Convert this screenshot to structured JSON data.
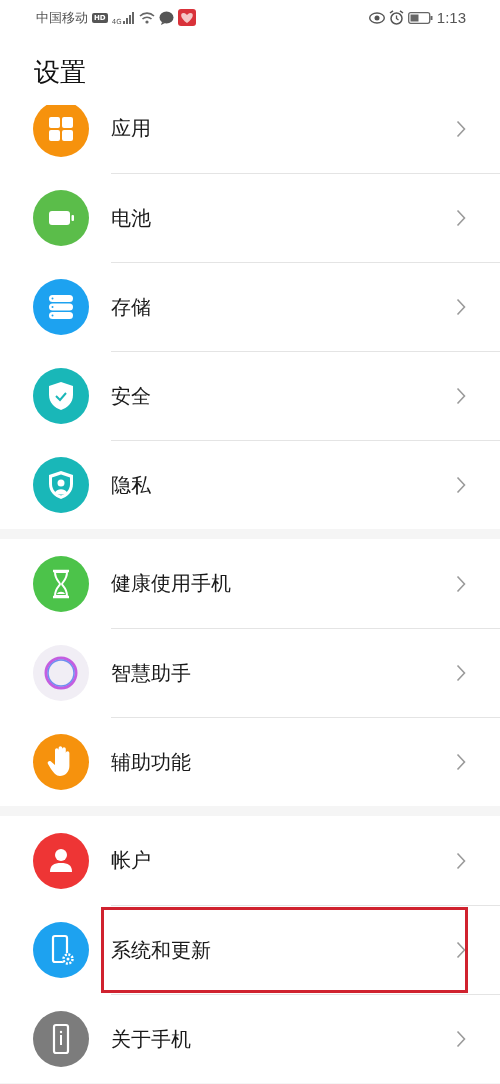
{
  "status_bar": {
    "carrier": "中国移动",
    "hd_badge": "HD",
    "network_type": "4G",
    "time": "1:13"
  },
  "title": "设置",
  "groups": [
    {
      "items": [
        {
          "label": "应用",
          "highlighted": false
        },
        {
          "label": "电池",
          "highlighted": false
        },
        {
          "label": "存储",
          "highlighted": false
        },
        {
          "label": "安全",
          "highlighted": false
        },
        {
          "label": "隐私",
          "highlighted": false
        }
      ]
    },
    {
      "items": [
        {
          "label": "健康使用手机",
          "highlighted": false
        },
        {
          "label": "智慧助手",
          "highlighted": false
        },
        {
          "label": "辅助功能",
          "highlighted": false
        }
      ]
    },
    {
      "items": [
        {
          "label": "帐户",
          "highlighted": false
        },
        {
          "label": "系统和更新",
          "highlighted": true
        },
        {
          "label": "关于手机",
          "highlighted": false
        }
      ]
    }
  ]
}
